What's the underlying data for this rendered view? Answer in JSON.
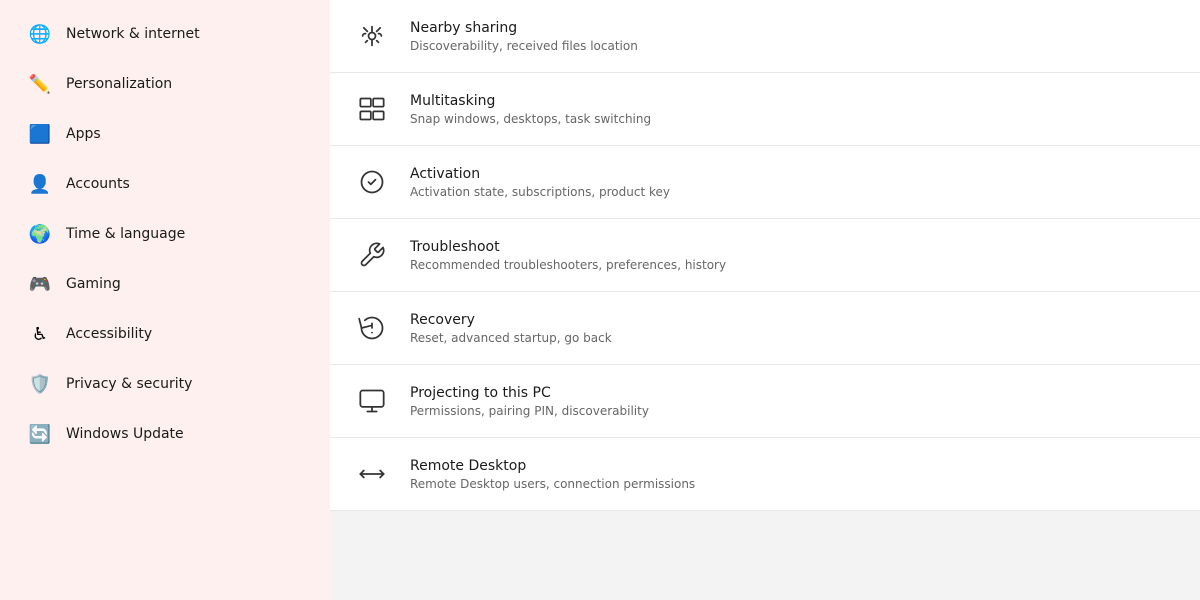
{
  "sidebar": {
    "items": [
      {
        "id": "network-internet",
        "label": "Network & internet",
        "icon": "🌐",
        "color": "#0078d4"
      },
      {
        "id": "personalization",
        "label": "Personalization",
        "icon": "✏️",
        "color": "#e74c3c"
      },
      {
        "id": "apps",
        "label": "Apps",
        "icon": "🟦",
        "color": "#0078d4"
      },
      {
        "id": "accounts",
        "label": "Accounts",
        "icon": "👤",
        "color": "#0078d4"
      },
      {
        "id": "time-language",
        "label": "Time & language",
        "icon": "🌍",
        "color": "#0078d4"
      },
      {
        "id": "gaming",
        "label": "Gaming",
        "icon": "🎮",
        "color": "#5c5cff"
      },
      {
        "id": "accessibility",
        "label": "Accessibility",
        "icon": "♿",
        "color": "#0078d4"
      },
      {
        "id": "privacy-security",
        "label": "Privacy & security",
        "icon": "🛡️",
        "color": "#555"
      },
      {
        "id": "windows-update",
        "label": "Windows Update",
        "icon": "🔄",
        "color": "#0078d4"
      }
    ]
  },
  "main": {
    "items": [
      {
        "id": "nearby-sharing",
        "title": "Nearby sharing",
        "description": "Discoverability, received files location",
        "icon": "nearby-sharing"
      },
      {
        "id": "multitasking",
        "title": "Multitasking",
        "description": "Snap windows, desktops, task switching",
        "icon": "multitasking"
      },
      {
        "id": "activation",
        "title": "Activation",
        "description": "Activation state, subscriptions, product key",
        "icon": "activation"
      },
      {
        "id": "troubleshoot",
        "title": "Troubleshoot",
        "description": "Recommended troubleshooters, preferences, history",
        "icon": "troubleshoot"
      },
      {
        "id": "recovery",
        "title": "Recovery",
        "description": "Reset, advanced startup, go back",
        "icon": "recovery"
      },
      {
        "id": "projecting",
        "title": "Projecting to this PC",
        "description": "Permissions, pairing PIN, discoverability",
        "icon": "projecting"
      },
      {
        "id": "remote-desktop",
        "title": "Remote Desktop",
        "description": "Remote Desktop users, connection permissions",
        "icon": "remote-desktop"
      }
    ]
  }
}
